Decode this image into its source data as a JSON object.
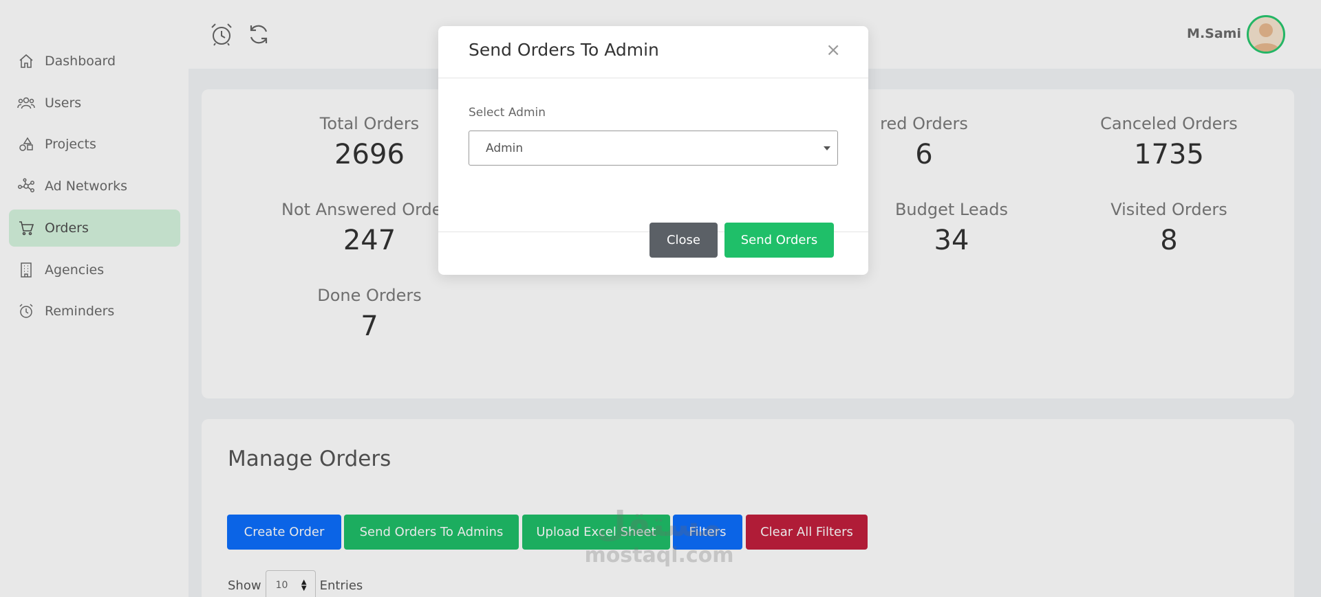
{
  "sidebar": {
    "items": [
      {
        "label": "Dashboard",
        "icon": "home-icon"
      },
      {
        "label": "Users",
        "icon": "users-icon"
      },
      {
        "label": "Projects",
        "icon": "shapes-icon"
      },
      {
        "label": "Ad Networks",
        "icon": "network-icon"
      },
      {
        "label": "Orders",
        "icon": "cart-icon",
        "active": true
      },
      {
        "label": "Agencies",
        "icon": "building-icon"
      },
      {
        "label": "Reminders",
        "icon": "alarm-icon"
      }
    ],
    "active_color": "#d6f5df"
  },
  "header": {
    "icons": [
      "alarm-icon",
      "refresh-icon"
    ],
    "username": "M.Sami",
    "avatar_border_color": "#28c76f"
  },
  "stats": [
    {
      "label": "Total Orders",
      "value": "2696"
    },
    {
      "label": "red Orders",
      "value": "6"
    },
    {
      "label": "Canceled Orders",
      "value": "1735"
    },
    {
      "label": "Not Answered Orders",
      "value": "247"
    },
    {
      "label": "Budget Leads",
      "value": "34"
    },
    {
      "label": "Visited Orders",
      "value": "8"
    },
    {
      "label": "Done Orders",
      "value": "7"
    }
  ],
  "orders": {
    "title": "Manage Orders",
    "buttons": {
      "create": "Create Order",
      "send": "Send Orders To Admins",
      "upload": "Upload Excel Sheet",
      "filters": "Filters",
      "clear": "Clear All Filters"
    },
    "show_label": "Show",
    "entries_value": "10",
    "entries_label": "Entries"
  },
  "watermark": {
    "arabic": "مستقل",
    "latin": "mostaql.com"
  },
  "modal": {
    "title": "Send Orders To Admin",
    "close_symbol": "×",
    "field_label": "Select Admin",
    "selected_admin": "Admin",
    "close_button": "Close",
    "send_button": "Send Orders"
  },
  "colors": {
    "primary_blue": "#0d6efd",
    "success_green": "#1fbf69",
    "danger_red": "#c21f3d",
    "secondary_gray": "#5b6066"
  }
}
